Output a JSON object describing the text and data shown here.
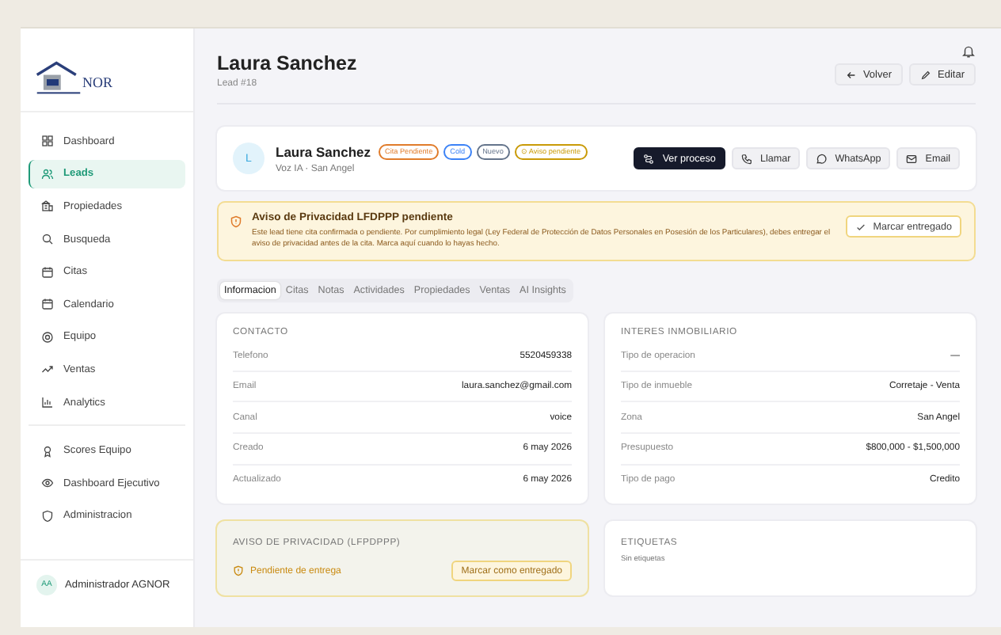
{
  "sidebar": {
    "logo_text": "NOR",
    "items": [
      {
        "label": "Dashboard",
        "selected": false
      },
      {
        "label": "Leads",
        "selected": true
      },
      {
        "label": "Propiedades",
        "selected": false
      },
      {
        "label": "Busqueda",
        "selected": false
      },
      {
        "label": "Citas",
        "selected": false
      },
      {
        "label": "Calendario",
        "selected": false
      },
      {
        "label": "Equipo",
        "selected": false
      },
      {
        "label": "Ventas",
        "selected": false
      },
      {
        "label": "Analytics",
        "selected": false
      }
    ],
    "items2": [
      {
        "label": "Scores Equipo",
        "selected": false
      },
      {
        "label": "Dashboard Ejecutivo",
        "selected": false
      },
      {
        "label": "Administracion",
        "selected": false
      }
    ],
    "user": {
      "initials": "AA",
      "name": "Administrador AGNOR"
    }
  },
  "header": {
    "title": "Laura Sanchez",
    "subtitle": "Lead #18",
    "buttons": [
      "Volver",
      "Editar"
    ]
  },
  "lead": {
    "initial": "L",
    "name": "Laura Sanchez",
    "meta": "Voz IA · San Angel",
    "badges": [
      {
        "label": "Cita Pendiente",
        "color": "#e07b2a"
      },
      {
        "label": "Cold",
        "color": "#3b82f6"
      },
      {
        "label": "Nuevo",
        "color": "#64748b"
      },
      {
        "label": "⊙ Aviso pendiente",
        "color": "#c99a06"
      }
    ],
    "actions": [
      {
        "label": "Ver proceso",
        "kind": "primary"
      },
      {
        "label": "Llamar",
        "kind": "secondary"
      },
      {
        "label": "WhatsApp",
        "kind": "secondary"
      },
      {
        "label": "Email",
        "kind": "secondary"
      }
    ]
  },
  "alert": {
    "title": "Aviso de Privacidad LFDPPP pendiente",
    "text": "Este lead tiene cita confirmada o pendiente. Por cumplimiento legal (Ley Federal de Protección de Datos Personales en Posesión de los Particulares), debes entregar el aviso de privacidad antes de la cita. Marca aquí cuando lo hayas hecho.",
    "button": "Marcar entregado"
  },
  "tabs": [
    {
      "label": "Informacion",
      "selected": true
    },
    {
      "label": "Citas",
      "selected": false
    },
    {
      "label": "Notas",
      "selected": false
    },
    {
      "label": "Actividades",
      "selected": false
    },
    {
      "label": "Propiedades",
      "selected": false
    },
    {
      "label": "Ventas",
      "selected": false
    },
    {
      "label": "AI Insights",
      "selected": false
    }
  ],
  "contacto": {
    "title": "CONTACTO",
    "rows": [
      {
        "label": "Telefono",
        "value": "5520459338"
      },
      {
        "label": "Email",
        "value": "laura.sanchez@gmail.com"
      },
      {
        "label": "Canal",
        "value": "voice"
      },
      {
        "label": "Creado",
        "value": "6 may 2026"
      },
      {
        "label": "Actualizado",
        "value": "6 may 2026"
      }
    ]
  },
  "interes": {
    "title": "INTERES INMOBILIARIO",
    "rows": [
      {
        "label": "Tipo de operacion",
        "value": "—"
      },
      {
        "label": "Tipo de inmueble",
        "value": "Corretaje - Venta"
      },
      {
        "label": "Zona",
        "value": "San Angel"
      },
      {
        "label": "Presupuesto",
        "value": "$800,000 - $1,500,000"
      },
      {
        "label": "Tipo de pago",
        "value": "Credito"
      }
    ]
  },
  "aviso": {
    "title": "AVISO DE PRIVACIDAD (LFPDPPP)",
    "status": "Pendiente de entrega",
    "button": "Marcar como entregado"
  },
  "etiquetas": {
    "title": "ETIQUETAS",
    "empty": "Sin etiquetas"
  }
}
